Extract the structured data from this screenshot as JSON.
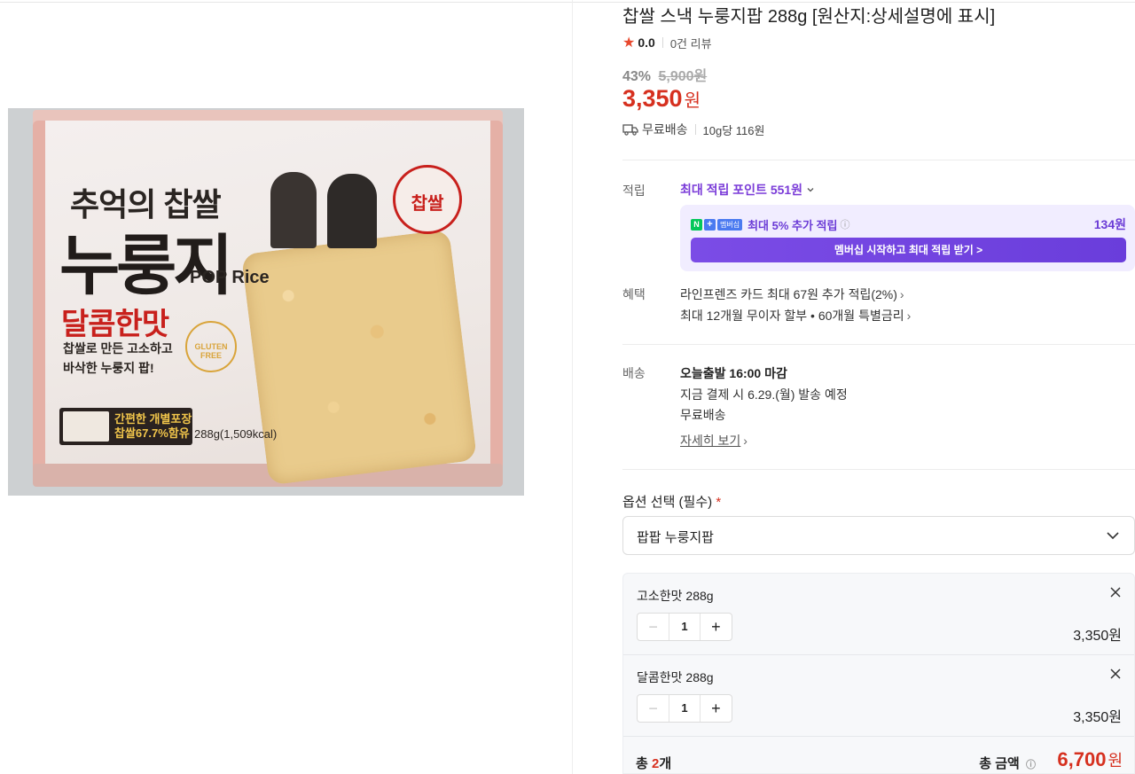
{
  "product": {
    "title": "찹쌀 스낵 누룽지팝 288g [원산지:상세설명에 표시]",
    "rating": "0.0",
    "review_count": "0건 리뷰",
    "discount_rate": "43%",
    "original_price": "5,900원",
    "price": "3,350",
    "price_unit": "원",
    "shipping": "무료배송",
    "unit_price": "10g당 116원"
  },
  "image": {
    "line1": "추억의 찹쌀",
    "line2": "누룽지",
    "pop": "POP Rice",
    "taste": "달콤한맛",
    "desc1": "찹쌀로 만든 고소하고",
    "desc2": "바삭한 누룽지 팝!",
    "pack1": "간편한 개별포장",
    "pack2": "찹쌀67.7%함유",
    "weight": "288g(1,509kcal)",
    "seal": "찹쌀",
    "gluten": "GLUTEN FREE"
  },
  "points": {
    "label": "적립",
    "max_points": "최대 적립 포인트 551원",
    "membership_text": "최대 5% 추가 적립",
    "membership_badge_n": "N",
    "membership_badge_plus": "+",
    "membership_badge": "멤버십",
    "membership_amount": "134원",
    "membership_button": "멤버십 시작하고 최대 적립 받기 >"
  },
  "benefits": {
    "label": "혜택",
    "line1": "라인프렌즈 카드 최대 67원 추가 적립(2%)",
    "line2": "최대 12개월 무이자 할부 • 60개월 특별금리"
  },
  "delivery": {
    "label": "배송",
    "title": "오늘출발 16:00 마감",
    "line1": "지금 결제 시 6.29.(월) 발송 예정",
    "line2": "무료배송",
    "detail_link": "자세히 보기"
  },
  "options": {
    "label": "옵션 선택 (필수)",
    "required_mark": "*",
    "selected": "팝팝 누룽지팝",
    "items": [
      {
        "name": "고소한맛 288g",
        "qty": "1",
        "price": "3,350원"
      },
      {
        "name": "달콤한맛 288g",
        "qty": "1",
        "price": "3,350원"
      }
    ]
  },
  "total": {
    "count_prefix": "총 ",
    "count": "2",
    "count_suffix": "개",
    "label": "총 금액",
    "amount": "6,700",
    "unit": "원"
  },
  "colors": {
    "accent_red": "#d6301f",
    "membership_purple": "#7a3bd8",
    "star": "#e8482d"
  }
}
